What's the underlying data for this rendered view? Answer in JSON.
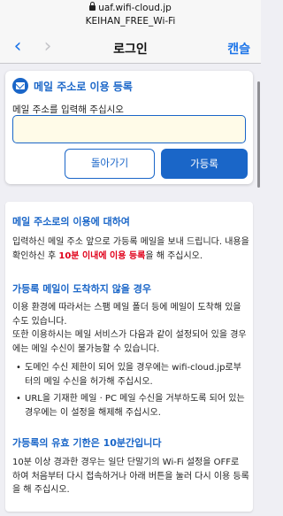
{
  "browser": {
    "url": "uaf.wifi-cloud.jp",
    "network_name": "KEIHAN_FREE_Wi-Fi"
  },
  "nav": {
    "title": "로그인",
    "cancel_label": "캔슬",
    "back_icon": "chevron-left-icon",
    "forward_icon": "chevron-right-icon"
  },
  "register": {
    "title": "메일 주소로 이용 등록",
    "input_label": "메일 주소를 입력해 주십시오",
    "input_value": "",
    "back_label": "돌아가기",
    "submit_label": "가등록",
    "accent_color": "#1a66c8"
  },
  "info": {
    "heading1": "메일 주소로의 이용에 대하여",
    "para1_part1": "입력하신 메일 주소 앞으로 가등록 메일을 보내 드립니다. 내용을 확인하신 후 ",
    "para1_highlight": "10분 이내에 이용 등록",
    "para1_part2": "을 해 주십시오.",
    "heading2": "가등록 메일이 도착하지 않을 경우",
    "para2": "이용 환경에 따라서는 스팸 메일 폴더 등에 메일이 도착해 있을 수도 있습니다.",
    "para3": "또한 이용하시는 메일 서비스가 다음과 같이 설정되어 있을 경우에는 메일 수신이 불가능할 수 있습니다.",
    "bullets": [
      "도메인 수신 제한이 되어 있을 경우에는 wifi-cloud.jp로부터의 메일 수신을 허가해 주십시오.",
      "URL을 기재한 메일 · PC 메일 수신을 거부하도록 되어 있는 경우에는 이 설정을 해제해 주십시오."
    ],
    "heading3": "가등록의 유효 기한은 10분간입니다",
    "para4": "10분 이상 경과한 경우는 일단 단말기의 Wi-Fi 설정을 OFF로 하여 처음부터 다시 접속하거나 아래 버튼을 눌러 다시 이용 등록을 해 주십시오.",
    "highlight_color": "#e0001a"
  }
}
